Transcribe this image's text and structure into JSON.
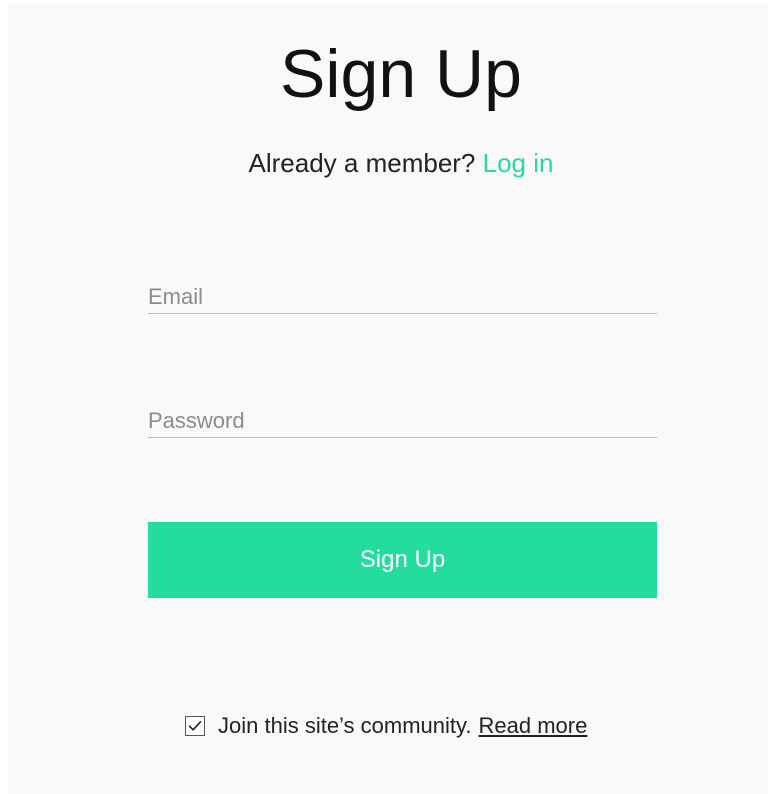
{
  "form": {
    "title": "Sign Up",
    "member_prompt": "Already a member?",
    "login_link": "Log in",
    "email_placeholder": "Email",
    "password_placeholder": "Password",
    "submit_label": "Sign Up"
  },
  "community": {
    "checked": true,
    "label": "Join this site’s community.",
    "read_more": "Read more"
  },
  "colors": {
    "accent": "#25dc9f",
    "link": "#2bd6a0",
    "background": "#f9f9f9"
  }
}
